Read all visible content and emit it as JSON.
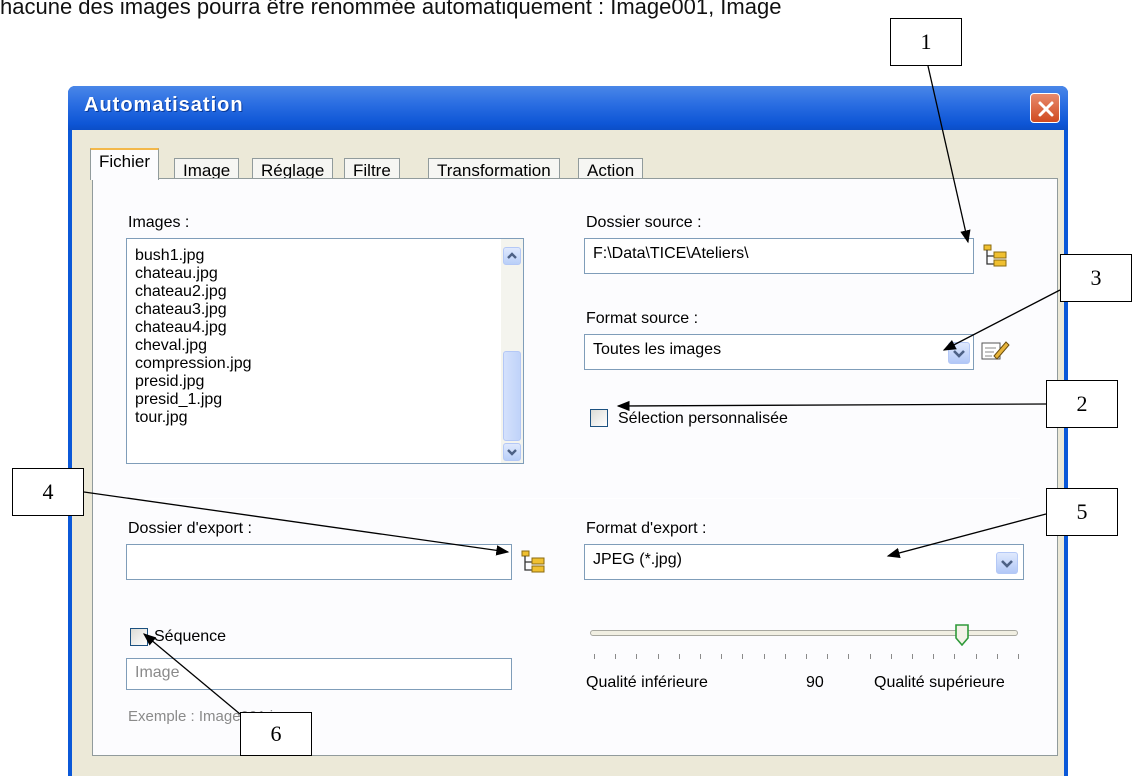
{
  "caption": "hacune des images pourra être renommée automatiquement : Image001, Image",
  "dialog": {
    "title": "Automatisation"
  },
  "tabs": [
    {
      "label": "Fichier",
      "active": true
    },
    {
      "label": "Image"
    },
    {
      "label": "Réglage"
    },
    {
      "label": "Filtre"
    },
    {
      "label": "Transformation"
    },
    {
      "label": "Action"
    }
  ],
  "images": {
    "label": "Images :",
    "items": [
      "bush1.jpg",
      "chateau.jpg",
      "chateau2.jpg",
      "chateau3.jpg",
      "chateau4.jpg",
      "cheval.jpg",
      "compression.jpg",
      "presid.jpg",
      "presid_1.jpg",
      "tour.jpg"
    ]
  },
  "source_folder": {
    "label": "Dossier source :",
    "value": "F:\\Data\\TICE\\Ateliers\\"
  },
  "source_format": {
    "label": "Format source :",
    "value": "Toutes les images"
  },
  "custom_selection": {
    "label": "Sélection personnalisée",
    "checked": false
  },
  "export_folder": {
    "label": "Dossier d'export :",
    "value": ""
  },
  "export_format": {
    "label": "Format d'export :",
    "value": "JPEG (*.jpg)"
  },
  "sequence": {
    "label": "Séquence",
    "checked": false,
    "prefix_placeholder": "Image",
    "example": "Exemple : Image001.jpg"
  },
  "quality": {
    "low_label": "Qualité inférieure",
    "value": "90",
    "high_label": "Qualité supérieure",
    "fraction": 0.87
  },
  "callouts": [
    "1",
    "2",
    "3",
    "4",
    "5",
    "6"
  ],
  "colors": {
    "titlebar": "#0b58d8",
    "dialog_bg": "#ece9d8",
    "close": "#d04a20",
    "tab_highlight": "#f3b84a"
  },
  "icons": [
    "close-icon",
    "folder-tree-icon",
    "edit-icon",
    "chevron-up-icon",
    "chevron-down-icon",
    "slider-thumb-icon"
  ]
}
